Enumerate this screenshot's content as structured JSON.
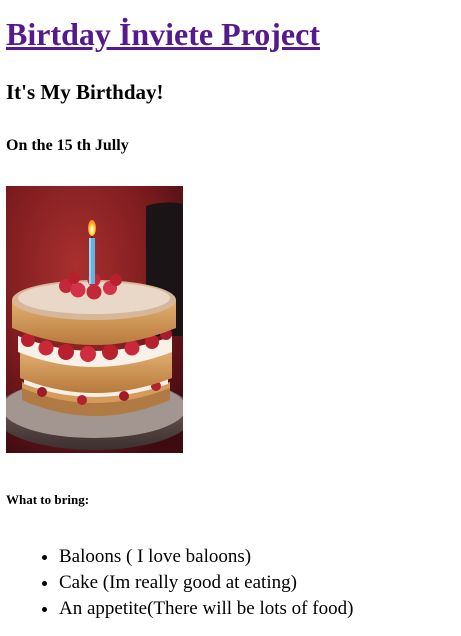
{
  "header": {
    "title": "Birtday İnviete Project",
    "subtitle": "It's My Birthday!",
    "date_line": "On the 15 th Jully"
  },
  "photo": {
    "icon": "birthday-cake-image"
  },
  "bring": {
    "heading": "What to bring:",
    "items": [
      "Baloons ( I love baloons)",
      "Cake (Im really good at eating)",
      "An appetite(There will be lots of food)"
    ]
  },
  "colors": {
    "link": "#551a8b"
  }
}
